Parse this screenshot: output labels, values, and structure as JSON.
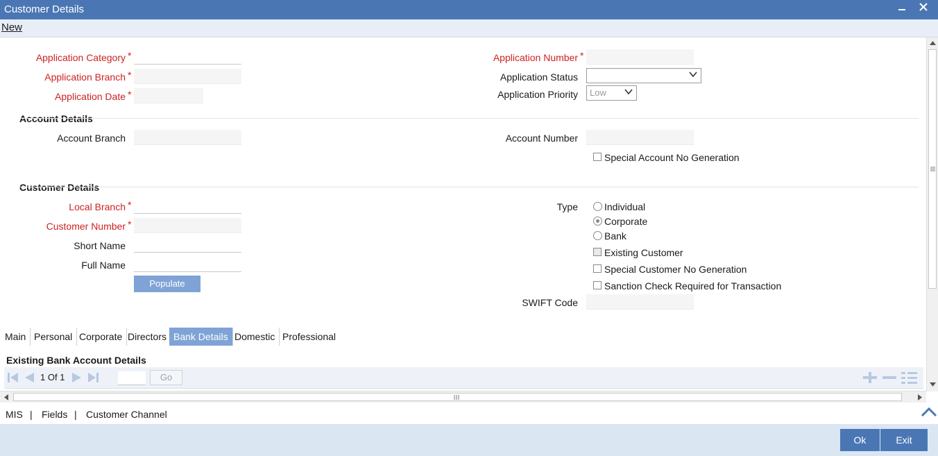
{
  "window": {
    "title": "Customer Details",
    "minimize_icon": "minimize-icon",
    "close_icon": "close-icon"
  },
  "toolbar": {
    "new_label": "New"
  },
  "application": {
    "category_label": "Application Category",
    "branch_label": "Application Branch",
    "date_label": "Application Date",
    "number_label": "Application Number",
    "status_label": "Application Status",
    "priority_label": "Application Priority",
    "priority_value": "Low",
    "required_mark": "*"
  },
  "account_details": {
    "heading": "Account Details",
    "branch_label": "Account Branch",
    "number_label": "Account Number",
    "special_no_gen_label": "Special Account No Generation"
  },
  "customer_details": {
    "heading": "Customer Details",
    "local_branch_label": "Local Branch",
    "customer_number_label": "Customer Number",
    "short_name_label": "Short Name",
    "full_name_label": "Full Name",
    "populate_label": "Populate",
    "type_label": "Type",
    "type_options": [
      "Individual",
      "Corporate",
      "Bank"
    ],
    "type_selected": "Corporate",
    "existing_customer_label": "Existing Customer",
    "special_customer_no_label": "Special Customer No Generation",
    "sanction_check_label": "Sanction Check Required for Transaction",
    "swift_code_label": "SWIFT Code"
  },
  "tabs": [
    "Main",
    "Personal",
    "Corporate",
    "Directors",
    "Bank Details",
    "Domestic",
    "Professional"
  ],
  "active_tab": "Bank Details",
  "bank_grid": {
    "heading": "Existing Bank Account Details",
    "page_current": "1",
    "page_of": "Of",
    "page_total": "1",
    "go_label": "Go"
  },
  "footer": {
    "links": [
      "MIS",
      "Fields",
      "Customer Channel"
    ],
    "separator": "|"
  },
  "actions": {
    "ok_label": "Ok",
    "exit_label": "Exit"
  },
  "colors": {
    "titlebar": "#4a77b4",
    "required": "#cc2222",
    "active_tab": "#7fa3d6",
    "bottombar": "#dbe6f3"
  }
}
